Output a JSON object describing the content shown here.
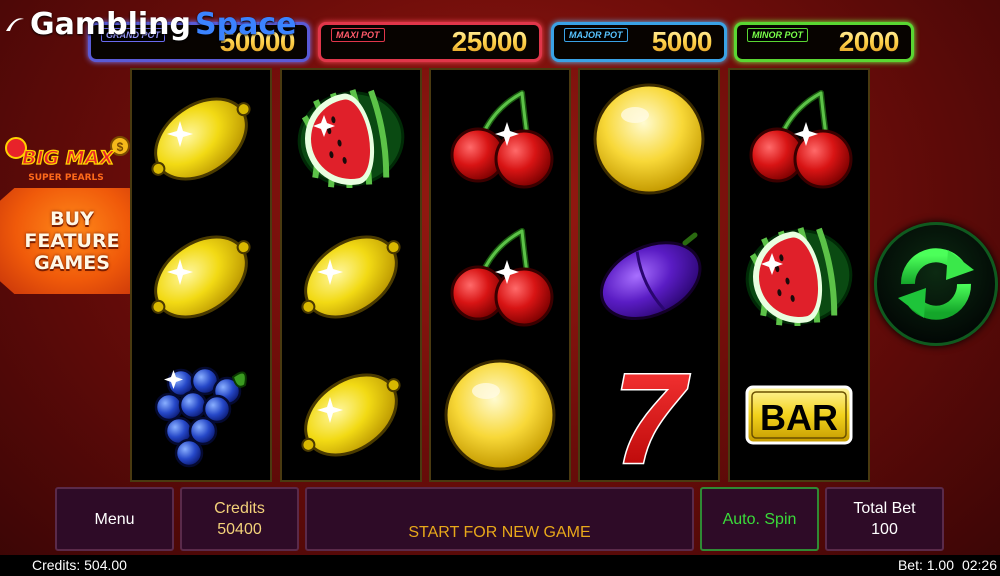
{
  "logo": {
    "word1": "Gambling",
    "word2": "Space"
  },
  "jackpots": [
    {
      "label": "GRAND POT",
      "value": "50000",
      "color": "#5a5ad6"
    },
    {
      "label": "MAXI POT",
      "value": "25000",
      "color": "#e0364a"
    },
    {
      "label": "MAJOR POT",
      "value": "5000",
      "color": "#3aa2e6"
    },
    {
      "label": "MINOR POT",
      "value": "2000",
      "color": "#5ad632"
    }
  ],
  "reels": [
    [
      "lemon",
      "lemon",
      "grapes"
    ],
    [
      "watermelon",
      "lemon",
      "lemon"
    ],
    [
      "cherries",
      "cherries",
      "golden-pearl"
    ],
    [
      "golden-pearl",
      "plum",
      "seven"
    ],
    [
      "cherries",
      "watermelon",
      "bar"
    ]
  ],
  "symbols": {
    "bar_text": "BAR",
    "seven_text": "7"
  },
  "feature": {
    "bigmax_title": "BIG MAX",
    "bigmax_subtitle": "SUPER PEARLS",
    "buy_label": "BUY\nFEATURE\nGAMES"
  },
  "panel": {
    "menu": "Menu",
    "credits_label": "Credits",
    "credits_value": "50400",
    "message": "START FOR NEW GAME",
    "autospin": "Auto. Spin",
    "totalbet_label": "Total Bet",
    "totalbet_value": "100"
  },
  "status": {
    "credits": "Credits: 504.00",
    "bet": "Bet: 1.00",
    "time": "02:26"
  },
  "colors": {
    "background": "#7a100b",
    "panel": "#2e0b27",
    "spin": "#1ec43a",
    "buy": "#f05a0a"
  }
}
